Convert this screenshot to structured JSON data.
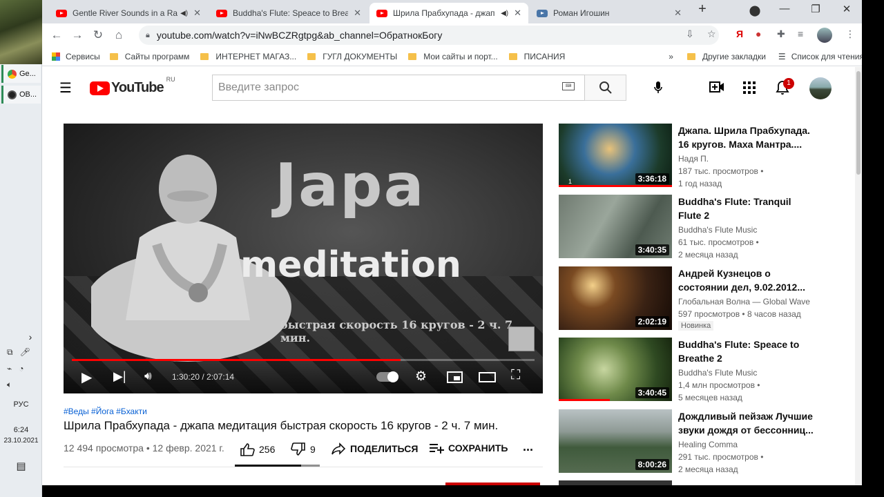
{
  "taskbar": {
    "apps": [
      {
        "label": "Ge...",
        "icon": "chrome-icon"
      },
      {
        "label": "OB...",
        "icon": "obs-icon"
      }
    ],
    "lang": "РУС",
    "time": "6:24",
    "date": "23.10.2021"
  },
  "browser": {
    "tabs": [
      {
        "title": "Gentle River Sounds in a Rai",
        "audio": true
      },
      {
        "title": "Buddha's Flute: Speace to Breath",
        "audio": false
      },
      {
        "title": "Шрила Прабхупада - джап",
        "audio": true
      },
      {
        "title": "Роман Игошин",
        "audio": false
      }
    ],
    "new_tab": "+",
    "url": "youtube.com/watch?v=iNwBCZRgtpg&ab_channel=ОбратнокБогу",
    "bookmarks": [
      "Сервисы",
      "Сайты программ",
      "ИНТЕРНЕТ МАГАЗ...",
      "ГУГЛ ДОКУМЕНТЫ",
      "Мои сайты и порт...",
      "ПИСАНИЯ"
    ],
    "bookmarks_more": "»",
    "other_bookmarks": "Другие закладки",
    "reading_list": "Список для чтения"
  },
  "youtube": {
    "logo": "YouTube",
    "logo_region": "RU",
    "search_placeholder": "Введите запрос",
    "notifications": "1"
  },
  "video": {
    "overlay_title": "Japa",
    "overlay_subtitle": "meditation",
    "overlay_caption": "быстрая скорость 16 кругов - 2 ч. 7 мин.",
    "time": "1:30:20 / 2:07:14",
    "progress": 0.71,
    "tags": "#Веды #Йога #Бхакти",
    "title": "Шрила Прабхупада - джапа медитация быстрая скорость 16 кругов - 2 ч. 7 мин.",
    "meta": "12 494 просмотра • 12 февр. 2021 г.",
    "likes": "256",
    "dislikes": "9",
    "share": "ПОДЕЛИТЬСЯ",
    "save": "СОХРАНИТЬ",
    "more": "...",
    "like_ratio": 0.78
  },
  "recommendations": [
    {
      "title": "Джапа. Шрила Прабхупада. 16 кругов. Маха Мантра....",
      "channel": "Надя П.",
      "views": "187 тыс. просмотров •",
      "age": "1 год назад",
      "duration": "3:36:18",
      "watched": 1.0,
      "badge": ""
    },
    {
      "title": "Buddha's Flute: Tranquil Flute 2",
      "channel": "Buddha's Flute Music",
      "views": "61 тыс. просмотров •",
      "age": "2 месяца назад",
      "duration": "3:40:35",
      "watched": 0,
      "badge": ""
    },
    {
      "title": "Андрей Кузнецов о состоянии дел, 9.02.2012...",
      "channel": "Глобальная Волна — Global Wave",
      "views": "597 просмотров • 8 часов назад",
      "age": "",
      "duration": "2:02:19",
      "watched": 0,
      "badge": "Новинка"
    },
    {
      "title": "Buddha's Flute: Speace to Breathe 2",
      "channel": "Buddha's Flute Music",
      "views": "1,4 млн просмотров •",
      "age": "5 месяцев назад",
      "duration": "3:40:45",
      "watched": 0.45,
      "badge": ""
    },
    {
      "title": "Дождливый пейзаж Лучшие звуки дождя от бессонниц...",
      "channel": "Healing Comma",
      "views": "291 тыс. просмотров •",
      "age": "2 месяца назад",
      "duration": "8:00:26",
      "watched": 0,
      "badge": ""
    }
  ]
}
